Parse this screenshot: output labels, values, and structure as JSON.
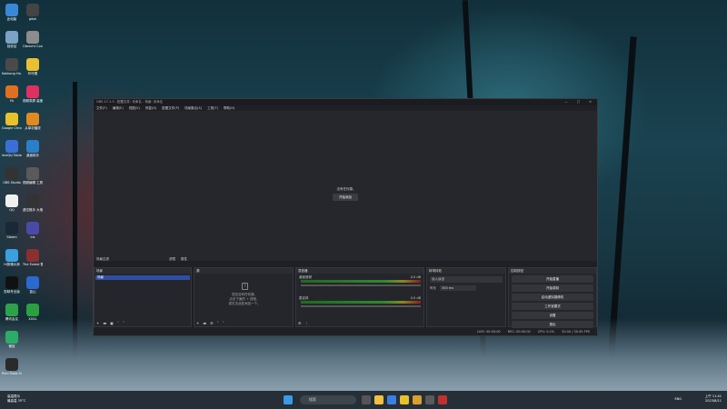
{
  "desktop": {
    "icons": [
      {
        "label": "此电脑",
        "color": "#3a87d6"
      },
      {
        "label": "回收站",
        "color": "#7aa3c6"
      },
      {
        "label": "Kakkong Ha...",
        "color": "#4a4a4a"
      },
      {
        "label": "FA",
        "color": "#e07020"
      },
      {
        "label": "Google Chrome",
        "color": "#e8c22a"
      },
      {
        "label": "imeQtJ Table...",
        "color": "#3a6fd6"
      },
      {
        "label": "OBS Studio",
        "color": "#333333"
      },
      {
        "label": "QQ",
        "color": "#f0f0f0"
      },
      {
        "label": "Steam",
        "color": "#1b2838"
      },
      {
        "label": "Hi剪辑大师",
        "color": "#3aa0e0"
      },
      {
        "label": "剪映专业版",
        "color": "#111111"
      },
      {
        "label": "腾讯会议",
        "color": "#2ea24a"
      },
      {
        "label": "微信",
        "color": "#2aae67"
      },
      {
        "label": "Pum Tools Simulator 2",
        "color": "#2a2a2a"
      }
    ],
    "icons_col2": [
      {
        "label": "gitsh",
        "color": "#444444"
      },
      {
        "label": "Obrecht Conteri",
        "color": "#8c8c8c"
      },
      {
        "label": "咔咔雪",
        "color": "#e8c030"
      },
      {
        "label": "视频录屏 高速版",
        "color": "#e03060"
      },
      {
        "label": "从单初播放",
        "color": "#e08a20"
      },
      {
        "label": "桌面助手",
        "color": "#2a80c8"
      },
      {
        "label": "视频编辑 工具",
        "color": "#5a5a5a"
      },
      {
        "label": "虚空猎手 大鬼...",
        "color": "#333333"
      },
      {
        "label": "ins",
        "color": "#4a4aa8"
      },
      {
        "label": "The Forest 雪境",
        "color": "#8a3030"
      },
      {
        "label": "蓝山",
        "color": "#2a6ad0"
      },
      {
        "label": "XXXL",
        "color": "#2aa040"
      }
    ]
  },
  "obs": {
    "title": "OBS 27.1.3 - 配置文件: 未命名 - 场景: 未命名",
    "window_controls": [
      "—",
      "□",
      "✕"
    ],
    "menu": [
      "文件(F)",
      "编辑(E)",
      "视图(V)",
      "停靠(D)",
      "配置文件(P)",
      "场景集合(S)",
      "工具(T)",
      "帮助(H)"
    ],
    "preview": {
      "no_source_text": "没有任何源。",
      "add_source_button": "开始添加"
    },
    "scene_bar": [
      "场景过滤",
      "滤镜",
      "属性"
    ],
    "docks": {
      "scenes": {
        "header": "场景",
        "selected": "场景"
      },
      "sources": {
        "header": "源",
        "empty_text": "您还没有任何源。\n点击下面的 + 按钮，\n或右击此处添加一个。"
      },
      "mixer": {
        "header": "混音器",
        "ch1": "桌面音频",
        "ch1_db": "0.0 dB",
        "ch2": "麦克风",
        "ch2_db": "0.0 dB"
      },
      "transitions": {
        "header": "转场特效",
        "type": "淡入淡出",
        "duration_label": "时长",
        "duration": "300 ms"
      },
      "controls": {
        "header": "控制按钮",
        "buttons": [
          "开始直播",
          "开始录制",
          "启动虚拟摄像机",
          "工作室模式",
          "设置",
          "退出"
        ]
      }
    },
    "status": {
      "live": "LIVE: 00:00:00",
      "rec": "REC: 00:00:00",
      "cpu": "CPU: 0.2%",
      "fps": "30.00 / 30.00 FPS"
    }
  },
  "taskbar": {
    "weather": "高温提示",
    "weather_sub": "最高温 35°C",
    "search_placeholder": "搜索",
    "time": "上午 11:41",
    "date": "2023/8/11",
    "lang": "ENG"
  }
}
